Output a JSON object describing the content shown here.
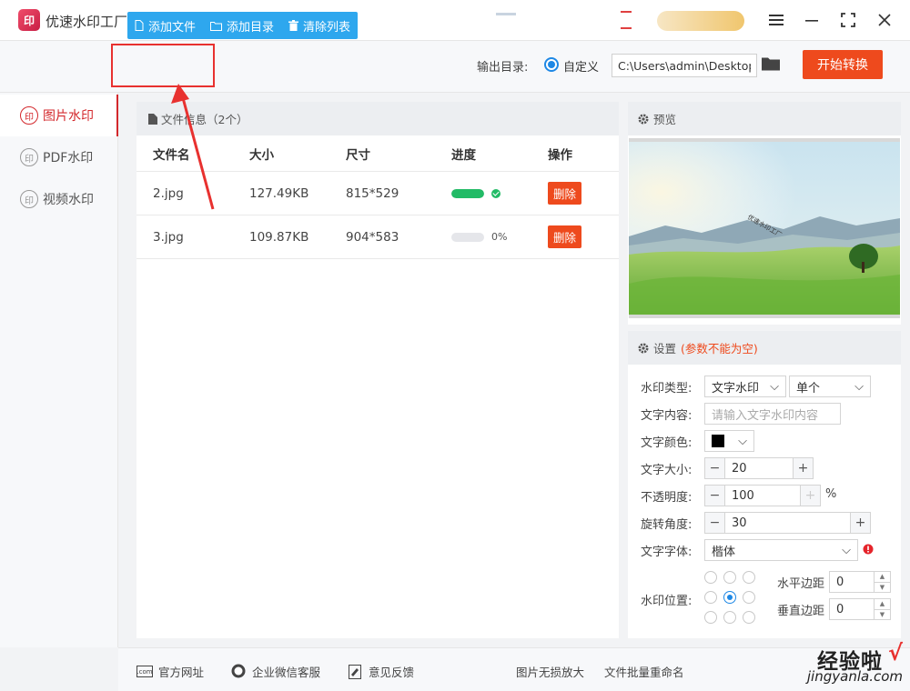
{
  "app": {
    "title": "优速水印工厂",
    "logo_text": "印"
  },
  "toolbar": {
    "add_file": "添加文件",
    "add_dir": "添加目录",
    "clear_list": "清除列表",
    "output_label": "输出目录:",
    "custom_label": "自定义",
    "output_path": "C:\\Users\\admin\\Desktop",
    "start_button": "开始转换"
  },
  "sidebar": {
    "items": [
      {
        "label": "图片水印",
        "icon": "印",
        "active": true
      },
      {
        "label": "PDF水印",
        "icon": "印",
        "active": false
      },
      {
        "label": "视频水印",
        "icon": "印",
        "active": false
      }
    ]
  },
  "file_panel": {
    "header": "文件信息（2个）",
    "columns": [
      "文件名",
      "大小",
      "尺寸",
      "进度",
      "操作"
    ],
    "rows": [
      {
        "name": "2.jpg",
        "size": "127.49KB",
        "dims": "815*529",
        "progress": 1.0,
        "progress_text": "",
        "done": true,
        "action": "删除"
      },
      {
        "name": "3.jpg",
        "size": "109.87KB",
        "dims": "904*583",
        "progress": 0.0,
        "progress_text": "0%",
        "done": false,
        "action": "删除"
      }
    ]
  },
  "preview": {
    "header": "预览",
    "watermark_text": "优速水印工厂"
  },
  "settings": {
    "header": "设置",
    "header_note": "(参数不能为空)",
    "type_label": "水印类型:",
    "type_value": "文字水印",
    "mode_value": "单个",
    "content_label": "文字内容:",
    "content_placeholder": "请输入文字水印内容",
    "color_label": "文字颜色:",
    "color_value": "#000000",
    "size_label": "文字大小:",
    "size_value": "20",
    "opacity_label": "不透明度:",
    "opacity_value": "100",
    "opacity_unit": "%",
    "rotate_label": "旋转角度:",
    "rotate_value": "30",
    "font_label": "文字字体:",
    "font_value": "楷体",
    "position_label": "水印位置:",
    "position_selected": "middle-center",
    "h_margin_label": "水平边距",
    "h_margin_value": "0",
    "v_margin_label": "垂直边距",
    "v_margin_value": "0"
  },
  "footer": {
    "items": [
      "官方网址",
      "企业微信客服",
      "意见反馈",
      "图片无损放大",
      "文件批量重命名"
    ],
    "site_icon_text": ".com"
  },
  "watermark_overlay": {
    "cn": "经验啦",
    "check": "√",
    "url": "jingyanla.com"
  },
  "colors": {
    "accent_blue": "#2ea7ee",
    "accent_red": "#ee4a1d",
    "active_red": "#d3282c",
    "success_green": "#22bb66"
  }
}
